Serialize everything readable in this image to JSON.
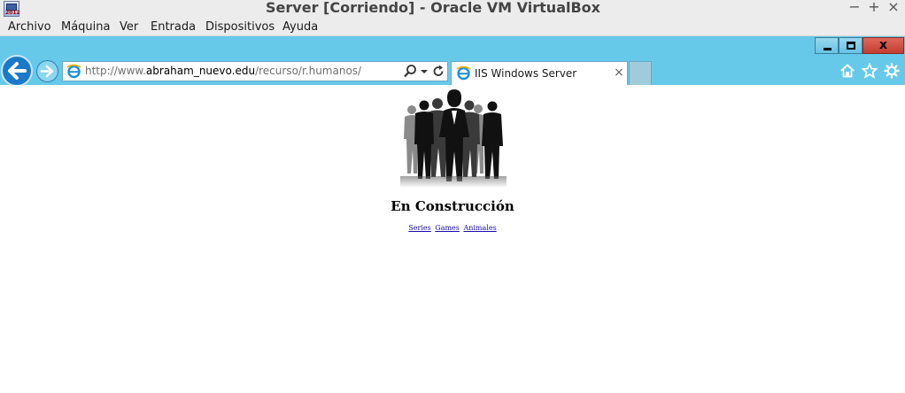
{
  "vbox": {
    "title": "Server [Corriendo] - Oracle VM VirtualBox",
    "app_icon_label": "2012",
    "controls": {
      "minimize": "−",
      "maximize": "+",
      "close": "×"
    },
    "menu": [
      "Archivo",
      "Máquina",
      "Ver",
      "Entrada",
      "Dispositivos",
      "Ayuda"
    ]
  },
  "browser": {
    "window_controls": {
      "close": "x"
    },
    "address": {
      "url_prefix": "http://www.",
      "url_domain": "abraham_nuevo.edu",
      "url_path": "/recurso/r.humanos/"
    },
    "tab": {
      "title": "IIS Windows Server",
      "close": "×"
    },
    "icons": [
      "back-arrow-icon",
      "forward-arrow-icon",
      "ie-logo-icon",
      "search-icon",
      "dropdown-icon",
      "refresh-icon",
      "home-icon",
      "star-icon",
      "gear-icon"
    ],
    "accent_color": "#66c9ea"
  },
  "page": {
    "heading": "En Construcción",
    "links": [
      "Series",
      "Games",
      "Animales"
    ]
  }
}
